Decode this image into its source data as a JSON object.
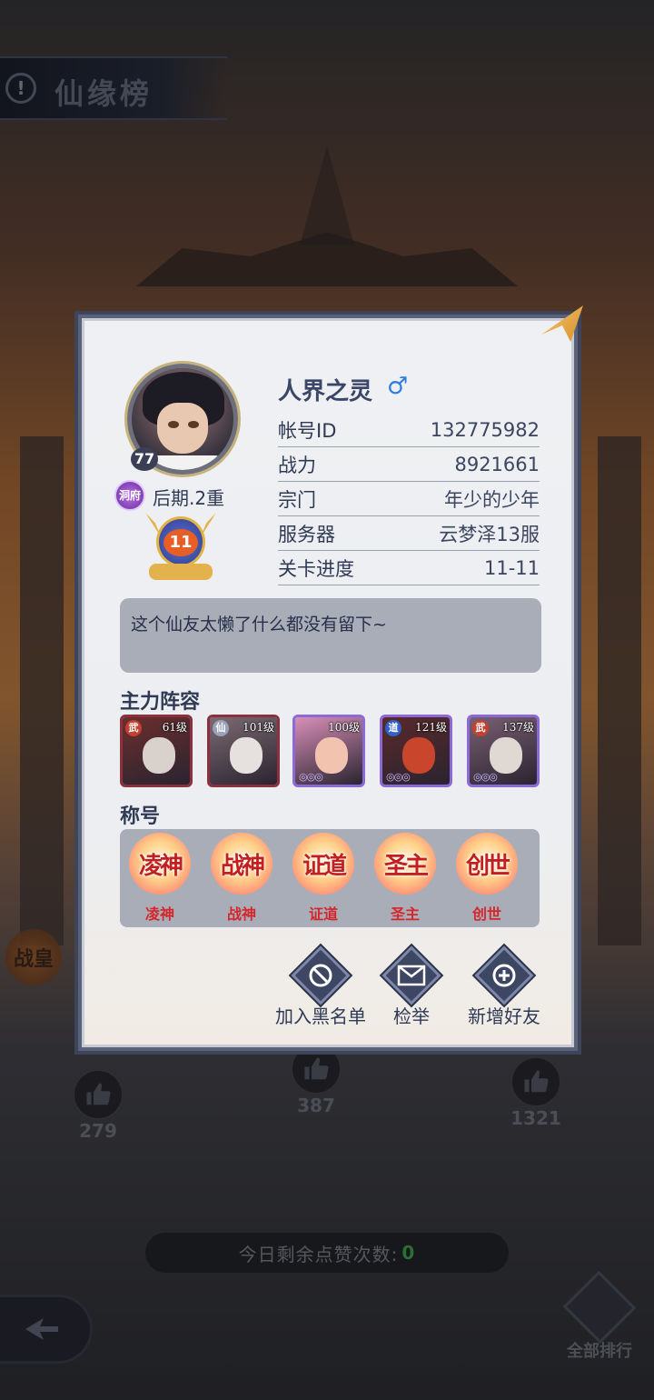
{
  "header": {
    "title": "仙缘榜",
    "info_icon": "!"
  },
  "side_badge": "战皇",
  "likes": [
    {
      "count": "279"
    },
    {
      "count": "387"
    },
    {
      "count": "1321"
    }
  ],
  "likes_remaining": {
    "label": "今日剩余点赞次数:",
    "value": "0"
  },
  "all_rank_label": "全部排行",
  "profile": {
    "name": "人界之灵",
    "gender_symbol": "♂",
    "level": "77",
    "realm_badge": "洞府",
    "realm": "后期.2重",
    "vip_level": "11",
    "info": [
      {
        "key": "帐号ID",
        "value": "132775982"
      },
      {
        "key": "战力",
        "value": "8921661"
      },
      {
        "key": "宗门",
        "value": "年少的少年"
      },
      {
        "key": "服务器",
        "value": "云梦泽13服"
      },
      {
        "key": "关卡进度",
        "value": "11-11"
      }
    ],
    "signature": "这个仙友太懒了什么都没有留下~"
  },
  "lineup": {
    "title": "主力阵容",
    "heroes": [
      {
        "type": "武",
        "level": "61级",
        "type_color": "#c2412f",
        "bg": "#6b2e2e",
        "face": "#d9d2cc",
        "frame": "red"
      },
      {
        "type": "仙",
        "level": "101级",
        "type_color": "#ffffff",
        "bg": "#7c6a72",
        "face": "#e6e0de",
        "frame": "red"
      },
      {
        "type": "",
        "level": "100级",
        "type_color": "#000000",
        "bg": "#d88fb8",
        "face": "#f2c4b0",
        "frame": "purple"
      },
      {
        "type": "道",
        "level": "121级",
        "type_color": "#2f61c9",
        "bg": "#5a2a2a",
        "face": "#c9462d",
        "frame": "purple"
      },
      {
        "type": "武",
        "level": "137级",
        "type_color": "#c2412f",
        "bg": "#7a5f73",
        "face": "#e0d8d2",
        "frame": "purple"
      }
    ]
  },
  "titles": {
    "title": "称号",
    "items": [
      {
        "emblem": "凌神",
        "label": "凌神"
      },
      {
        "emblem": "战神",
        "label": "战神"
      },
      {
        "emblem": "证道",
        "label": "证道"
      },
      {
        "emblem": "圣主",
        "label": "圣主"
      },
      {
        "emblem": "创世",
        "label": "创世"
      }
    ]
  },
  "actions": {
    "blacklist": "加入黑名单",
    "report": "检举",
    "add_friend": "新增好友"
  }
}
